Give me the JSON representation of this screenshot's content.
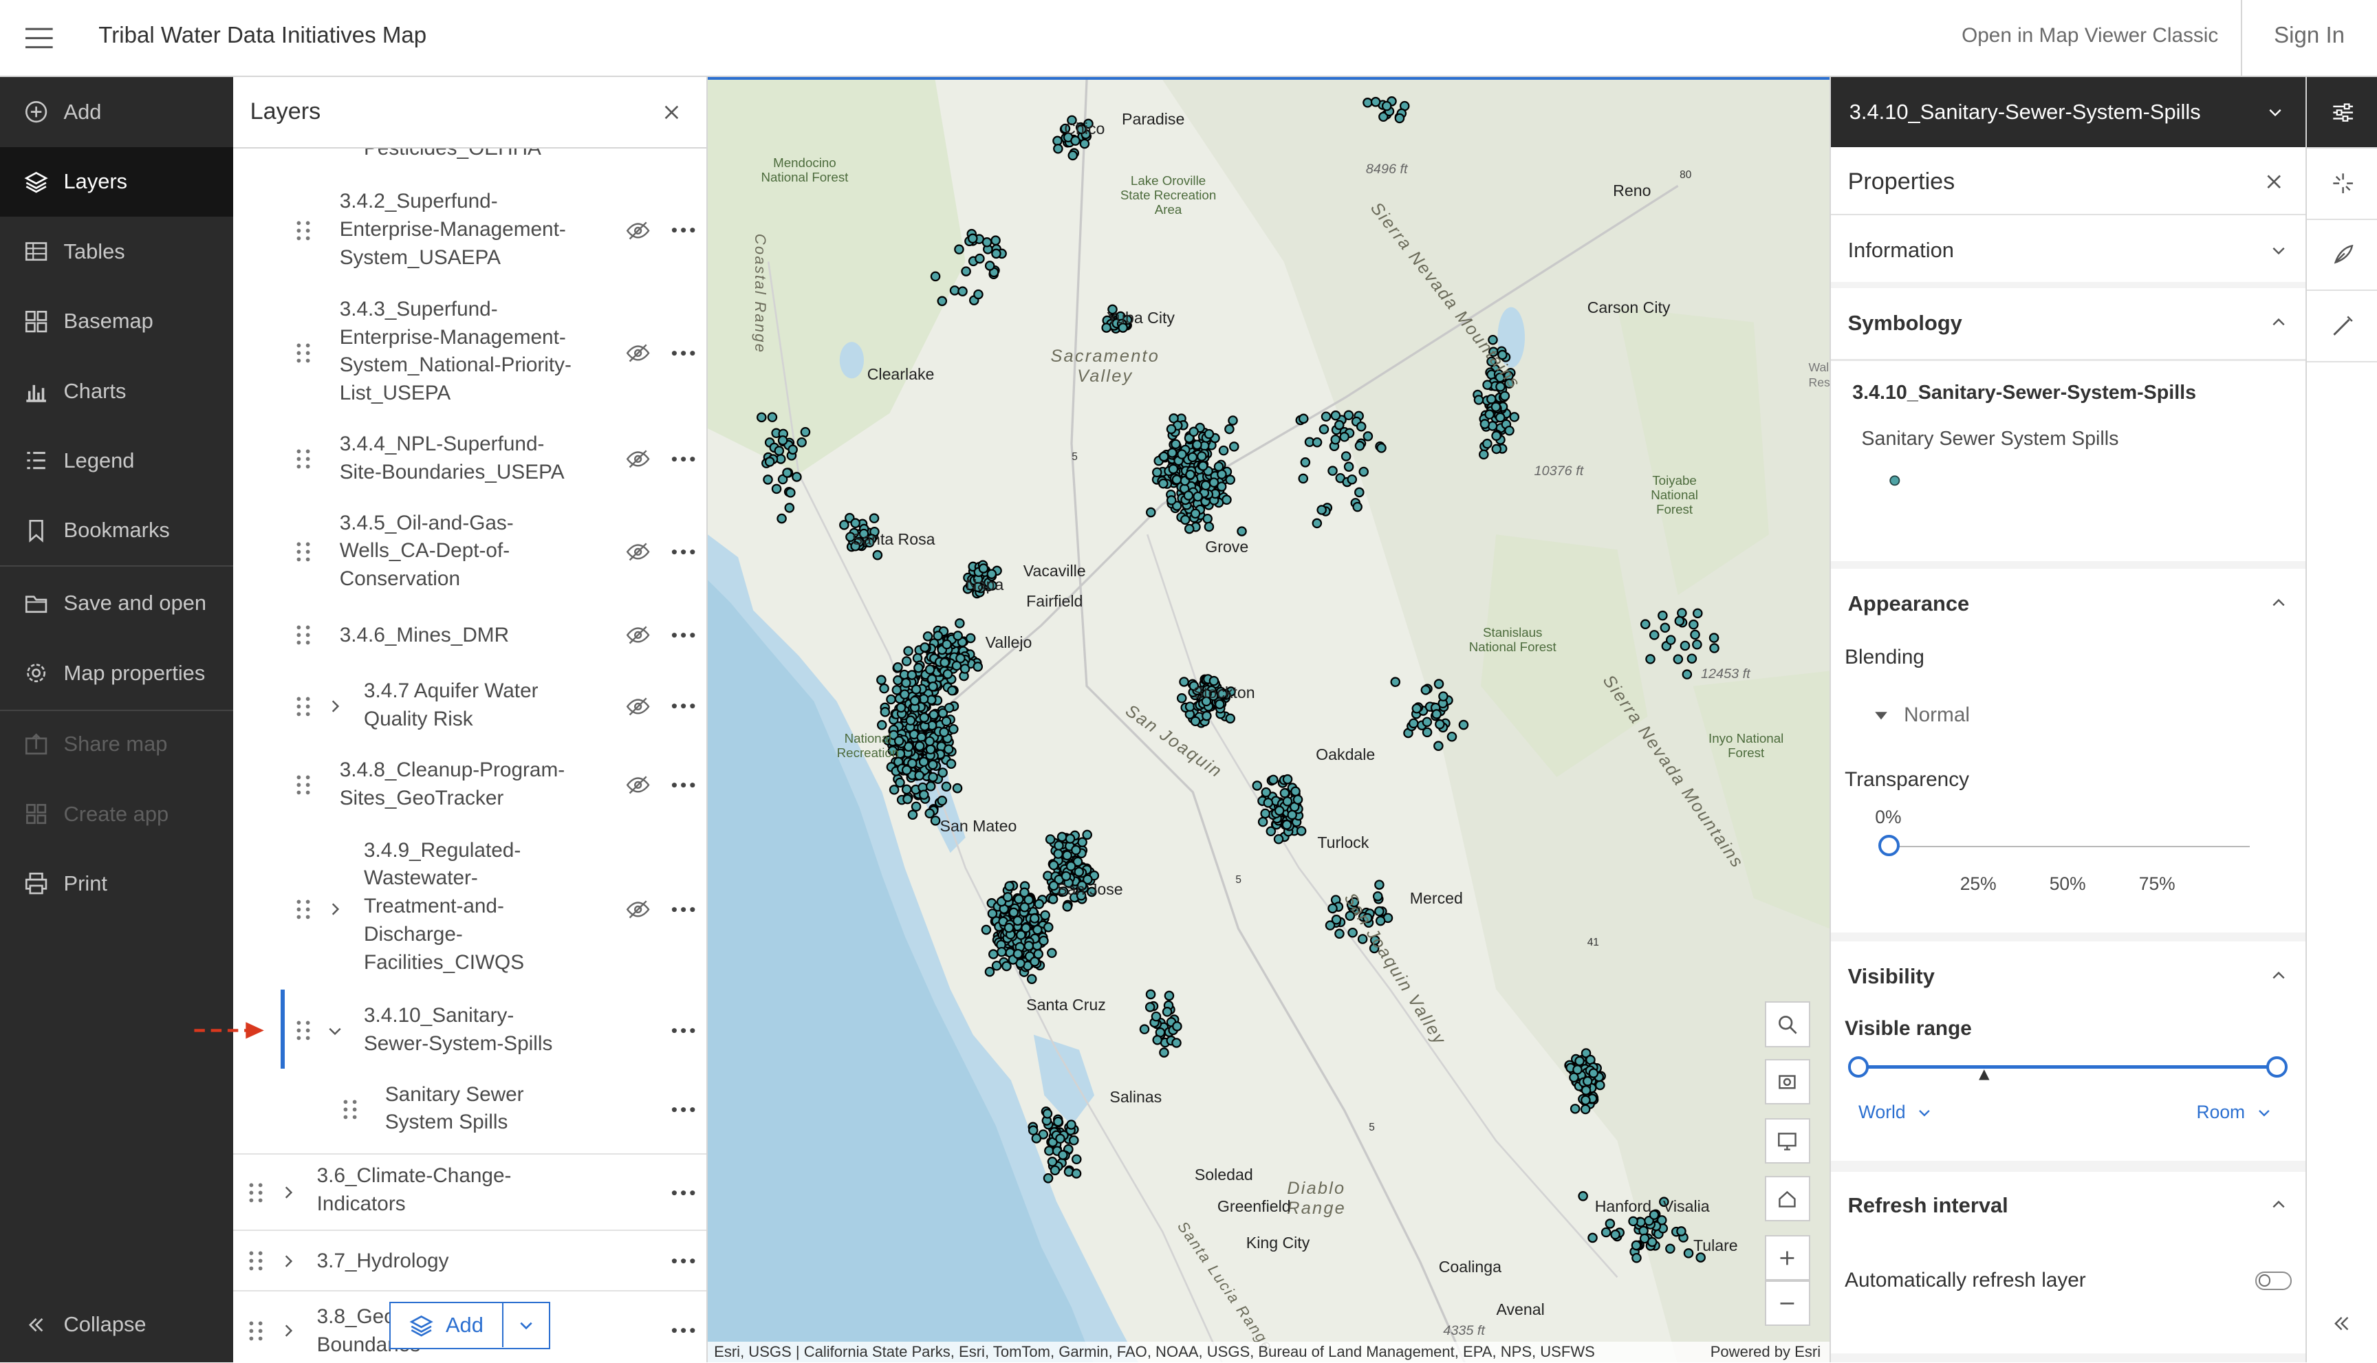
{
  "header": {
    "title": "Tribal Water Data Initiatives Map",
    "open_classic": "Open in Map Viewer Classic",
    "sign_in": "Sign In"
  },
  "nav": {
    "items": [
      {
        "label": "Add",
        "icon": "plus-circle-icon"
      },
      {
        "label": "Layers",
        "icon": "layers-icon"
      },
      {
        "label": "Tables",
        "icon": "table-icon"
      },
      {
        "label": "Basemap",
        "icon": "basemap-icon"
      },
      {
        "label": "Charts",
        "icon": "chart-icon"
      },
      {
        "label": "Legend",
        "icon": "legend-icon"
      },
      {
        "label": "Bookmarks",
        "icon": "bookmark-icon"
      },
      {
        "label": "Save and open",
        "icon": "folder-icon"
      },
      {
        "label": "Map properties",
        "icon": "gear-icon"
      },
      {
        "label": "Share map",
        "icon": "share-icon"
      },
      {
        "label": "Create app",
        "icon": "apps-icon"
      },
      {
        "label": "Print",
        "icon": "print-icon"
      }
    ],
    "collapse": "Collapse"
  },
  "layers_panel": {
    "title": "Layers",
    "partial_top": "Pesticides_OEHHA",
    "items": [
      {
        "lines": [
          "3.4.2_Superfund-",
          "Enterprise-Management-",
          "System_USAEPA"
        ]
      },
      {
        "lines": [
          "3.4.3_Superfund-",
          "Enterprise-Management-",
          "System_National-Priority-",
          "List_USEPA"
        ]
      },
      {
        "lines": [
          "3.4.4_NPL-Superfund-",
          "Site-Boundaries_USEPA"
        ]
      },
      {
        "lines": [
          "3.4.5_Oil-and-Gas-",
          "Wells_CA-Dept-of-",
          "Conservation"
        ]
      },
      {
        "lines": [
          "3.4.6_Mines_DMR"
        ]
      },
      {
        "lines": [
          "3.4.7 Aquifer Water",
          "Quality Risk"
        ]
      },
      {
        "lines": [
          "3.4.8_Cleanup-Program-",
          "Sites_GeoTracker"
        ]
      },
      {
        "lines": [
          "3.4.9_Regulated-",
          "Wastewater-",
          "Treatment-and-",
          "Discharge-",
          "Facilities_CIWQS"
        ]
      },
      {
        "lines": [
          "3.4.10_Sanitary-",
          "Sewer-System-Spills"
        ]
      },
      {
        "lines": [
          "Sanitary Sewer",
          "System Spills"
        ]
      },
      {
        "lines": [
          "3.6_Climate-Change-",
          "Indicators"
        ]
      },
      {
        "lines": [
          "3.7_Hydrology"
        ]
      },
      {
        "lines": [
          "3.8_Geo",
          "Boundaries"
        ]
      }
    ],
    "add_label": "Add"
  },
  "map": {
    "labels": {
      "chico": "Chico",
      "paradise": "Paradise",
      "mendocino": "Mendocino\nNational Forest",
      "lake_oroville": "Lake Oroville\nState Recreation\nArea",
      "elev1": "8496 ft",
      "reno": "Reno",
      "sierra_nevada_mtn": "Sierra Nevada Mountains",
      "coastal_range": "Coastal Range",
      "yuba": "Yuba City",
      "sacramento_valley": "Sacramento\nValley",
      "carson": "Carson City",
      "clearlake": "Clearlake",
      "elev2": "10376 ft",
      "toiyabe": "Toiyabe\nNational\nForest",
      "santa_rosa": "Santa Rosa",
      "grove": "Grove",
      "vacaville": "Vacaville",
      "napa": "Napa",
      "fairfield": "Fairfield",
      "vallejo": "Vallejo",
      "stanislaus": "Stanislaus\nNational Forest",
      "elev3": "12453 ft",
      "stockton": "Stockton",
      "sierra_nevada2": "Sierra Nevada Mountains",
      "oakdale": "Oakdale",
      "inyo": "Inyo National\nForest",
      "nat_rec": "National\nRecreation",
      "san_joaquin": "San Joaquin",
      "turlock": "Turlock",
      "san_mateo": "San Mateo",
      "san_jose": "San Jose",
      "merced": "Merced",
      "san_joaquin_valley": "San Joaquin Valley",
      "santa_cruz": "Santa Cruz",
      "salinas": "Salinas",
      "soledad": "Soledad",
      "diablo": "Diablo\nRange",
      "greenfield": "Greenfield",
      "king_city": "King City",
      "hanford": "Hanford",
      "visalia": "Visalia",
      "tulare": "Tulare",
      "coalinga": "Coalinga",
      "avenal": "Avenal",
      "elev4": "4335 ft",
      "santa_lucia": "Santa Lucia Range",
      "wal": "Wal",
      "res": "Res"
    },
    "shields": {
      "i80": "80",
      "i5a": "5",
      "i5b": "5",
      "i5c": "5",
      "r41": "41"
    },
    "attribution": "Esri, USGS | California State Parks, Esri, TomTom, Garmin, FAO, NOAA, USGS, Bureau of Land Management, EPA, NPS, USFWS",
    "powered": "Powered by Esri",
    "point_fill": "#4fa3a5"
  },
  "properties": {
    "layer_name": "3.4.10_Sanitary-Sewer-System-Spills",
    "title": "Properties",
    "information": "Information",
    "symbology": "Symbology",
    "symbology_layer": "3.4.10_Sanitary-Sewer-System-Spills",
    "symbology_item": "Sanitary Sewer System Spills",
    "appearance": "Appearance",
    "blending": "Blending",
    "blending_value": "Normal",
    "transparency": "Transparency",
    "transparency_value": "0%",
    "ticks": [
      "25%",
      "50%",
      "75%"
    ],
    "visibility": "Visibility",
    "visible_range": "Visible range",
    "range_min": "World",
    "range_max": "Room",
    "refresh": "Refresh interval",
    "auto_refresh": "Automatically refresh layer"
  },
  "colors": {
    "accent": "#2b6fd0",
    "nav_bg": "#2b2b2b",
    "arrow": "#d9381e"
  }
}
